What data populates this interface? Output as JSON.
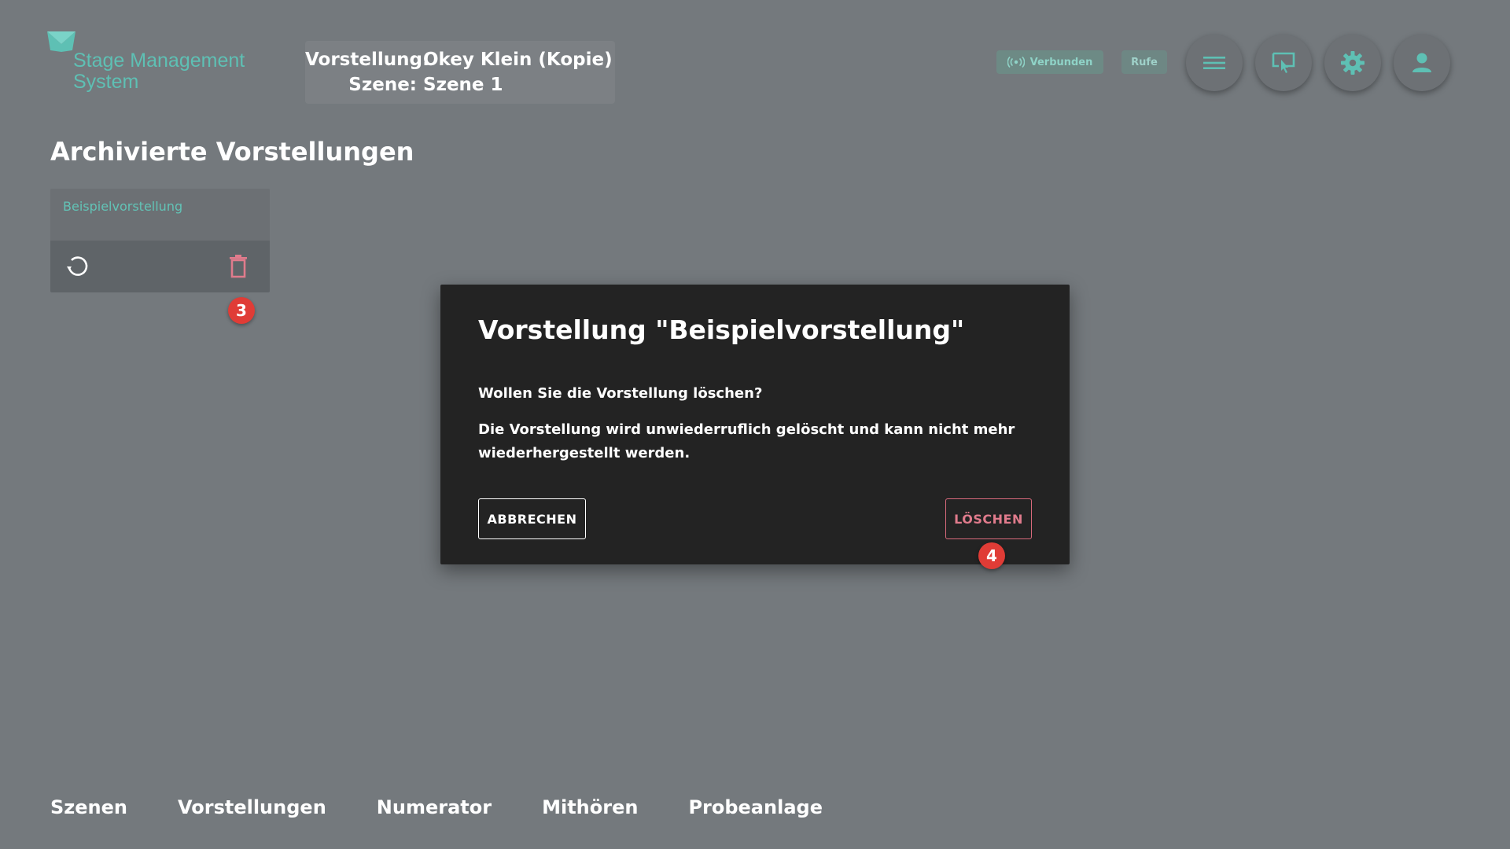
{
  "header": {
    "logo_line1": "Stage Management",
    "logo_line2": "System",
    "performance_label": "Vorstellung:",
    "performance_value": "Okey Klein (Kopie)",
    "scene_label": "Szene:",
    "scene_value": "Szene 1",
    "connected_label": "Verbunden",
    "calls_label": "Rufe",
    "icons": [
      "menu-icon",
      "screen-touch-icon",
      "gear-icon",
      "user-icon"
    ]
  },
  "main": {
    "title": "Archivierte Vorstellungen",
    "cards": [
      {
        "name": "Beispielvorstellung"
      }
    ]
  },
  "annotations": {
    "badge_delete_card": "3",
    "badge_delete_confirm": "4"
  },
  "dialog": {
    "title": "Vorstellung \"Beispielvorstellung\"",
    "question": "Wollen Sie die Vorstellung löschen?",
    "body": "Die Vorstellung wird unwiederruflich gelöscht und kann nicht mehr wiederhergestellt werden.",
    "cancel_label": "ABBRECHEN",
    "delete_label": "LÖSCHEN"
  },
  "bottom_nav": {
    "items": [
      "Szenen",
      "Vorstellungen",
      "Numerator",
      "Mithören",
      "Probeanlage"
    ]
  },
  "colors": {
    "background": "#74797d",
    "accent_teal": "#5ec0b4",
    "danger": "#e07b8c",
    "dialog_bg": "#232323",
    "badge": "#e03c36"
  }
}
